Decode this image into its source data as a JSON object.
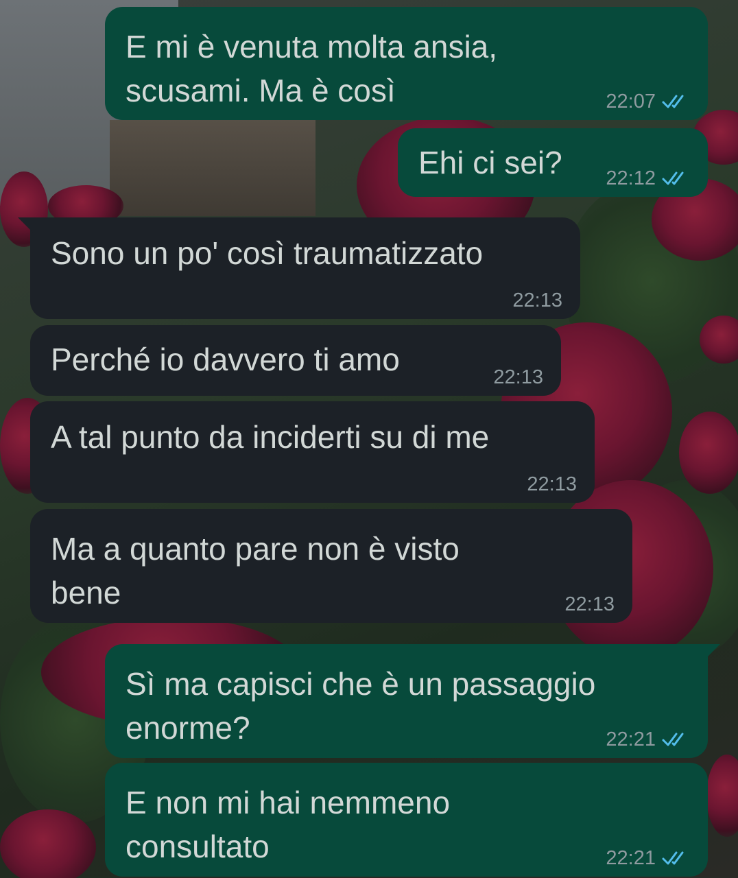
{
  "colors": {
    "outgoing_bubble": "#074a3b",
    "incoming_bubble": "#1c2127",
    "message_text": "#d2d8d6",
    "timestamp": "#8f9ba0",
    "read_ticks": "#53bdeb"
  },
  "messages": [
    {
      "direction": "outgoing",
      "text": "E mi è venuta molta ansia,\nscusami. Ma è così",
      "time": "22:07",
      "status_icon": "double-check-icon"
    },
    {
      "direction": "outgoing",
      "text": "Ehi ci sei?",
      "time": "22:12",
      "status_icon": "double-check-icon"
    },
    {
      "direction": "incoming",
      "text": "Sono un po' così traumatizzato",
      "time": "22:13"
    },
    {
      "direction": "incoming",
      "text": "Perché io davvero ti amo",
      "time": "22:13"
    },
    {
      "direction": "incoming",
      "text": "A tal punto da inciderti su di me",
      "time": "22:13"
    },
    {
      "direction": "incoming",
      "text": "Ma a quanto pare non è visto\nbene",
      "time": "22:13"
    },
    {
      "direction": "outgoing",
      "text": "Sì ma capisci che è un passaggio\nenorme?",
      "time": "22:21",
      "status_icon": "double-check-icon"
    },
    {
      "direction": "outgoing",
      "text": "E non mi hai nemmeno\nconsultato",
      "time": "22:21",
      "status_icon": "double-check-icon"
    }
  ]
}
